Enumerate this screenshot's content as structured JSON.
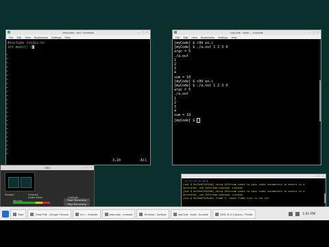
{
  "editor": {
    "title": "test-main - vim + terminal",
    "menu": [
      "File",
      "Edit",
      "View",
      "Bookmarks",
      "Settings",
      "Help"
    ],
    "lines": [
      "#include <stdio.h>",
      "",
      "int main() {"
    ],
    "status_pos": "3,10",
    "status_all": "All"
  },
  "term_right": {
    "title": "myCode : bash — Konsole",
    "menu": [
      "File",
      "Edit",
      "View",
      "Bookmarks",
      "Settings",
      "Help"
    ],
    "lines": [
      "[myCode] $ c99 ex.c",
      "[myCode] $ ./a.out 1 2 3 4",
      "argc = 5",
      "./a.out",
      "1",
      "2",
      "3",
      "4",
      "sum = 10",
      "[myCode] $ c99 ex.c",
      "[myCode] $ ./a.out 1 2 3 4",
      "argc = 5",
      "./a.out",
      "1",
      "2",
      "3",
      "4",
      "sum = 10",
      "[myCode] $ "
    ]
  },
  "obs": {
    "title": "OBS",
    "scenes_label": "Scenes",
    "sources_label": "Sources",
    "audio_label": "Audio Mixer",
    "controls_label": "Controls",
    "start_streaming": "Start Streaming",
    "start_recording": "Stop Recording",
    "mic_label": "Mic/Aux"
  },
  "log_term": {
    "lines": [
      "-[1_12:14:25.452]",
      "[swt @ 0x55ed73452a0] Using AVStream.codec to pass codec parameters to muxers is d",
      "eprecated, use AVStream.codecpar instead.",
      "[swt @ 0x55ed73452a0] Using AVStream.codec to pass codec parameters to muxers is d",
      "eprecated, use AVStream.codecpar instead.",
      "[swt @ 0x55ed73452a0] frame I: codec frame size is not set"
    ]
  },
  "taskbar": {
    "items": [
      "Start",
      "Tests Fall - Google Chrome",
      "ex.c - Konsole",
      "test-main - konsole",
      "Terminal - konsole",
      "myCode : bash - konsole",
      "OBS 21.0.3 (linux) - Profile"
    ],
    "clock": "1:41 PM"
  },
  "colors": {
    "desktop": "#0b2f2c",
    "terminal_bg": "#000000",
    "prompt_text": "#e6e6e6",
    "vim_lnum": "#bdbd5a",
    "vim_include": "#e678e6",
    "vim_keyword": "#68d068",
    "cursor": "#7ad6d6",
    "log_text": "#d8d040"
  }
}
